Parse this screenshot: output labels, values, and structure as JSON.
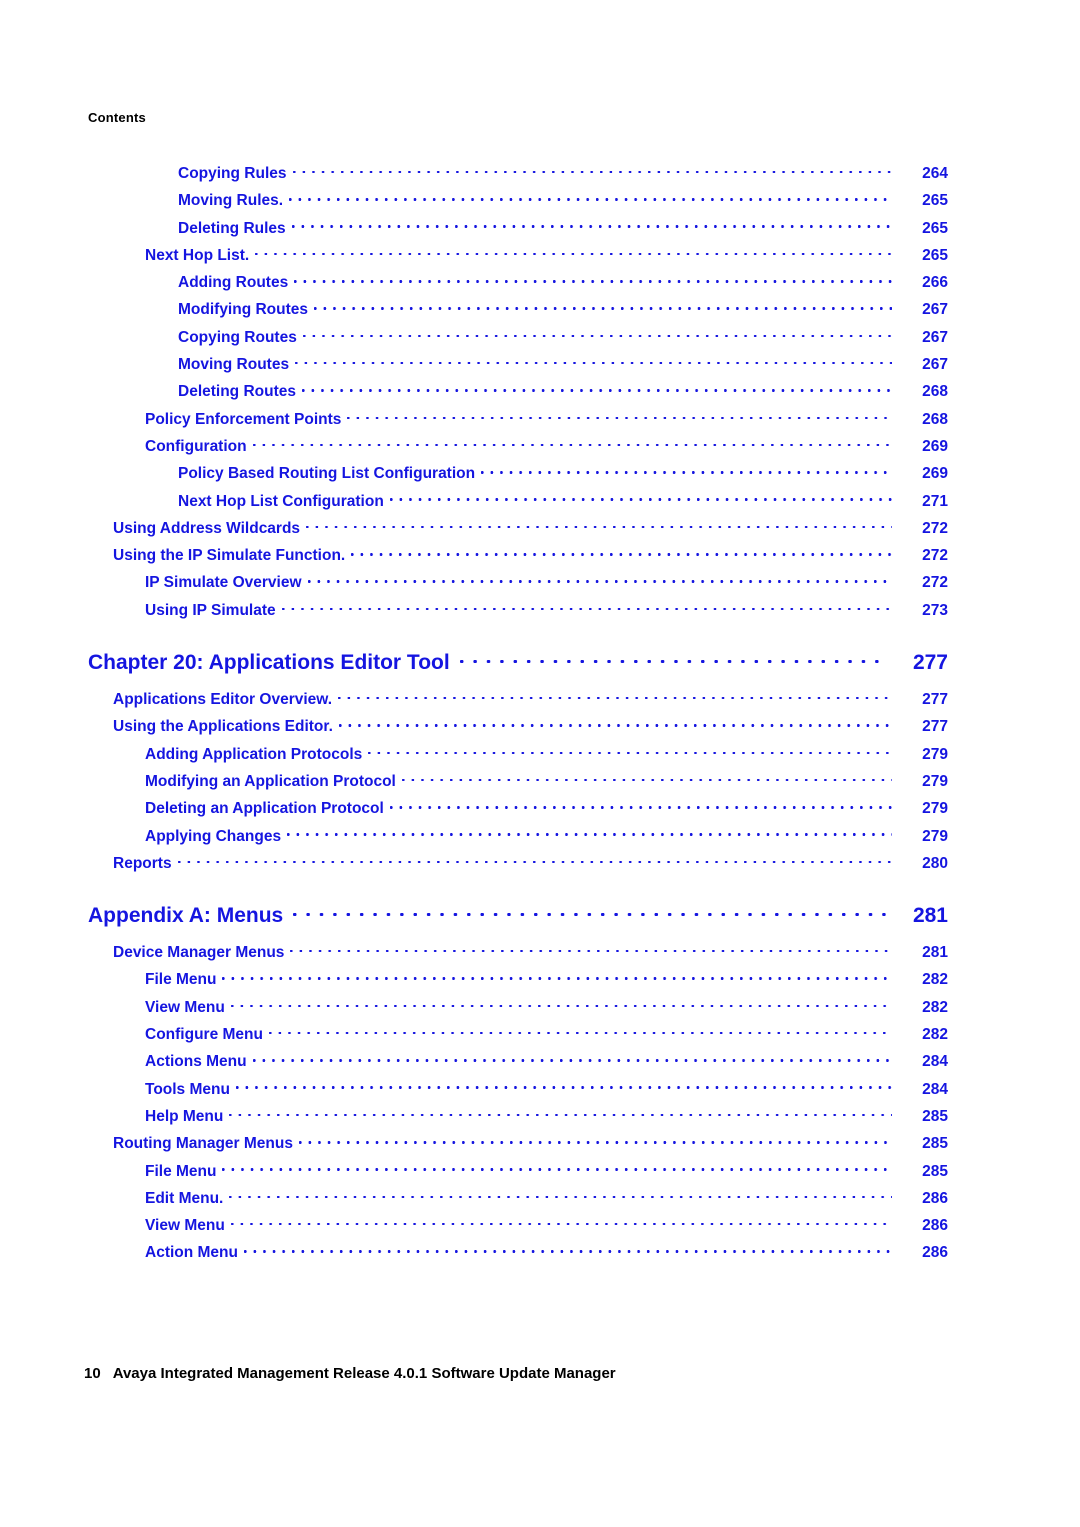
{
  "page": {
    "running_head": "Contents",
    "background_color": "#ffffff",
    "link_color": "#1515e0",
    "text_color": "#000000"
  },
  "footer": {
    "folio": "10",
    "document_title": "Avaya Integrated Management Release 4.0.1 Software Update Manager"
  },
  "toc": {
    "entries": [
      {
        "label": "Copying Rules",
        "page": "264",
        "level": 3,
        "kind": "entry"
      },
      {
        "label": "Moving Rules.",
        "page": "265",
        "level": 3,
        "kind": "entry"
      },
      {
        "label": "Deleting Rules",
        "page": "265",
        "level": 3,
        "kind": "entry"
      },
      {
        "label": "Next Hop List.",
        "page": "265",
        "level": 2,
        "kind": "entry"
      },
      {
        "label": "Adding Routes",
        "page": "266",
        "level": 3,
        "kind": "entry"
      },
      {
        "label": "Modifying Routes",
        "page": "267",
        "level": 3,
        "kind": "entry"
      },
      {
        "label": "Copying Routes",
        "page": "267",
        "level": 3,
        "kind": "entry"
      },
      {
        "label": "Moving Routes",
        "page": "267",
        "level": 3,
        "kind": "entry"
      },
      {
        "label": "Deleting Routes",
        "page": "268",
        "level": 3,
        "kind": "entry"
      },
      {
        "label": "Policy Enforcement Points",
        "page": "268",
        "level": 2,
        "kind": "entry"
      },
      {
        "label": "Configuration",
        "page": "269",
        "level": 2,
        "kind": "entry"
      },
      {
        "label": "Policy Based Routing List Configuration",
        "page": "269",
        "level": 3,
        "kind": "entry"
      },
      {
        "label": "Next Hop List Configuration",
        "page": "271",
        "level": 3,
        "kind": "entry"
      },
      {
        "label": "Using Address Wildcards",
        "page": "272",
        "level": 1,
        "kind": "entry"
      },
      {
        "label": "Using the IP Simulate Function.",
        "page": "272",
        "level": 1,
        "kind": "entry"
      },
      {
        "label": "IP Simulate Overview",
        "page": "272",
        "level": 2,
        "kind": "entry"
      },
      {
        "label": "Using IP Simulate",
        "page": "273",
        "level": 2,
        "kind": "entry"
      },
      {
        "label": "Chapter 20: Applications Editor Tool",
        "page": "277",
        "level": 0,
        "kind": "chapter"
      },
      {
        "label": "Applications Editor Overview.",
        "page": "277",
        "level": 1,
        "kind": "entry"
      },
      {
        "label": "Using the Applications Editor.",
        "page": "277",
        "level": 1,
        "kind": "entry"
      },
      {
        "label": "Adding Application Protocols",
        "page": "279",
        "level": 2,
        "kind": "entry"
      },
      {
        "label": "Modifying an Application Protocol",
        "page": "279",
        "level": 2,
        "kind": "entry"
      },
      {
        "label": "Deleting an Application Protocol",
        "page": "279",
        "level": 2,
        "kind": "entry"
      },
      {
        "label": "Applying Changes",
        "page": "279",
        "level": 2,
        "kind": "entry"
      },
      {
        "label": "Reports",
        "page": "280",
        "level": 1,
        "kind": "entry"
      },
      {
        "label": "Appendix A: Menus",
        "page": "281",
        "level": 0,
        "kind": "chapter"
      },
      {
        "label": "Device Manager Menus",
        "page": "281",
        "level": 1,
        "kind": "entry"
      },
      {
        "label": "File Menu",
        "page": "282",
        "level": 2,
        "kind": "entry"
      },
      {
        "label": "View Menu",
        "page": "282",
        "level": 2,
        "kind": "entry"
      },
      {
        "label": "Configure Menu",
        "page": "282",
        "level": 2,
        "kind": "entry"
      },
      {
        "label": "Actions Menu",
        "page": "284",
        "level": 2,
        "kind": "entry"
      },
      {
        "label": "Tools Menu",
        "page": "284",
        "level": 2,
        "kind": "entry"
      },
      {
        "label": "Help Menu",
        "page": "285",
        "level": 2,
        "kind": "entry"
      },
      {
        "label": "Routing Manager Menus",
        "page": "285",
        "level": 1,
        "kind": "entry"
      },
      {
        "label": "File Menu",
        "page": "285",
        "level": 2,
        "kind": "entry"
      },
      {
        "label": "Edit Menu.",
        "page": "286",
        "level": 2,
        "kind": "entry"
      },
      {
        "label": "View Menu",
        "page": "286",
        "level": 2,
        "kind": "entry"
      },
      {
        "label": "Action Menu",
        "page": "286",
        "level": 2,
        "kind": "entry"
      }
    ]
  }
}
